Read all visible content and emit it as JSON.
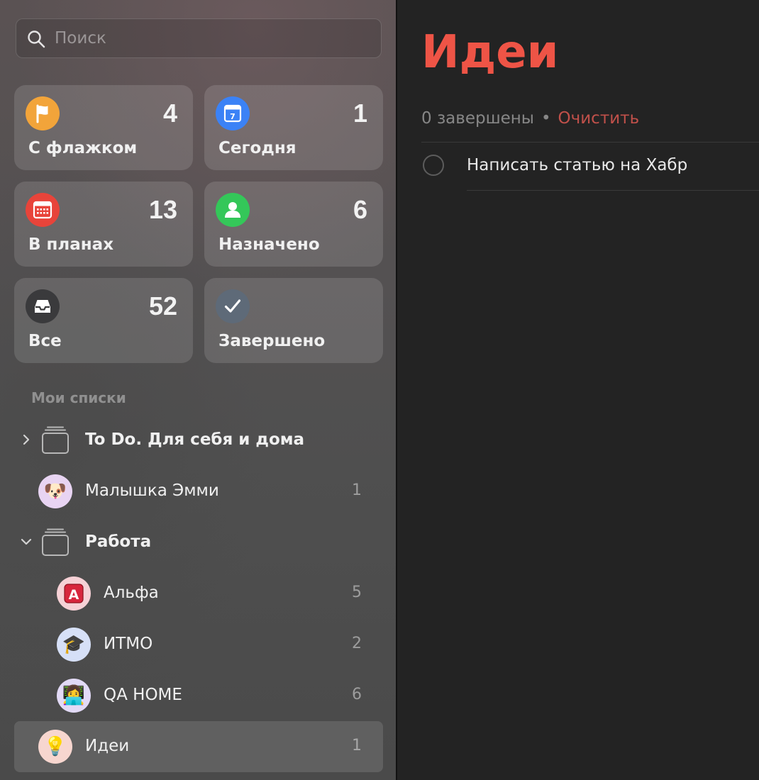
{
  "search": {
    "placeholder": "Поиск",
    "icon": "search-icon"
  },
  "smart_lists": [
    {
      "label": "С флажком",
      "count": "4",
      "icon": "flag-icon",
      "color": "#f2a43a"
    },
    {
      "label": "Сегодня",
      "count": "1",
      "icon": "calendar-today-icon",
      "color": "#3b82f6"
    },
    {
      "label": "В планах",
      "count": "13",
      "icon": "calendar-grid-icon",
      "color": "#e8443a"
    },
    {
      "label": "Назначено",
      "count": "6",
      "icon": "person-icon",
      "color": "#34c759"
    },
    {
      "label": "Все",
      "count": "52",
      "icon": "tray-icon",
      "color": "#3a3a3c"
    },
    {
      "label": "Завершено",
      "count": "",
      "icon": "checkmark-icon",
      "color": "#5e6a78"
    }
  ],
  "section_title": "Мои списки",
  "lists": [
    {
      "name": "To Do. Для себя и дома",
      "count": "",
      "type": "group",
      "expanded": false,
      "icon": "folder-stack-icon"
    },
    {
      "name": "Малышка Эмми",
      "count": "1",
      "type": "list",
      "emoji": "🐶",
      "avatar_color": "#e8d4f2"
    },
    {
      "name": "Работа",
      "count": "",
      "type": "group",
      "expanded": true,
      "icon": "folder-stack-icon"
    },
    {
      "name": "Альфа",
      "count": "5",
      "type": "list",
      "emoji": "🅰️",
      "avatar_color": "#f6d1d6"
    },
    {
      "name": "ИТМО",
      "count": "2",
      "type": "list",
      "emoji": "🎓",
      "avatar_color": "#d6e0f7"
    },
    {
      "name": "QA HOME",
      "count": "6",
      "type": "list",
      "emoji": "👩‍💻",
      "avatar_color": "#e2daf6"
    },
    {
      "name": "Идеи",
      "count": "1",
      "type": "list",
      "emoji": "💡",
      "avatar_color": "#f7d6cf",
      "selected": true
    }
  ],
  "main": {
    "title": "Идеи",
    "title_color": "#ee5446",
    "completed_text": "0 завершены",
    "separator": "•",
    "clear_label": "Очистить",
    "tasks": [
      {
        "text": "Написать статью на Хабр",
        "completed": false
      }
    ]
  }
}
